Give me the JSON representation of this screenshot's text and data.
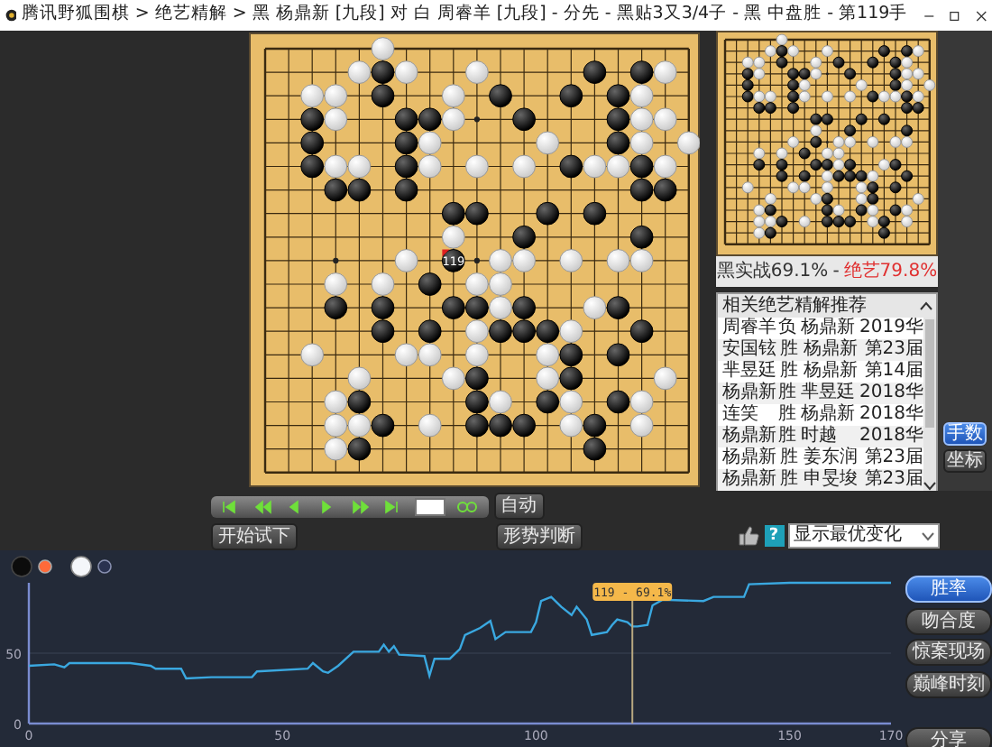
{
  "window": {
    "title": "腾讯野狐围棋 > 绝艺精解 > 黑 杨鼎新 [九段] 对 白 周睿羊 [九段] - 分先 - 黑贴3又3/4子 - 黑 中盘胜 - 第119手"
  },
  "board": {
    "rows": [
      {
        "points": [
          {
            "kind": "empty"
          },
          {
            "kind": "empty"
          },
          {
            "kind": "empty"
          },
          {
            "kind": "empty"
          },
          {
            "kind": "empty"
          },
          {
            "kind": "white"
          },
          {
            "kind": "empty"
          },
          {
            "kind": "empty"
          },
          {
            "kind": "empty"
          },
          {
            "kind": "empty"
          },
          {
            "kind": "empty"
          },
          {
            "kind": "empty"
          },
          {
            "kind": "empty"
          },
          {
            "kind": "empty"
          },
          {
            "kind": "empty"
          },
          {
            "kind": "empty"
          },
          {
            "kind": "empty"
          },
          {
            "kind": "empty"
          },
          {
            "kind": "empty"
          }
        ]
      },
      {
        "points": [
          {
            "kind": "empty"
          },
          {
            "kind": "empty"
          },
          {
            "kind": "empty"
          },
          {
            "kind": "empty"
          },
          {
            "kind": "white"
          },
          {
            "kind": "black"
          },
          {
            "kind": "white"
          },
          {
            "kind": "empty"
          },
          {
            "kind": "empty"
          },
          {
            "kind": "white"
          },
          {
            "kind": "empty"
          },
          {
            "kind": "empty"
          },
          {
            "kind": "empty"
          },
          {
            "kind": "empty"
          },
          {
            "kind": "black"
          },
          {
            "kind": "empty"
          },
          {
            "kind": "black"
          },
          {
            "kind": "white"
          },
          {
            "kind": "empty"
          }
        ]
      },
      {
        "points": [
          {
            "kind": "empty"
          },
          {
            "kind": "empty"
          },
          {
            "kind": "white"
          },
          {
            "kind": "white"
          },
          {
            "kind": "empty"
          },
          {
            "kind": "black"
          },
          {
            "kind": "empty"
          },
          {
            "kind": "empty"
          },
          {
            "kind": "white"
          },
          {
            "kind": "empty"
          },
          {
            "kind": "black"
          },
          {
            "kind": "empty"
          },
          {
            "kind": "empty"
          },
          {
            "kind": "black"
          },
          {
            "kind": "empty"
          },
          {
            "kind": "black"
          },
          {
            "kind": "white"
          },
          {
            "kind": "empty"
          },
          {
            "kind": "empty"
          }
        ]
      },
      {
        "points": [
          {
            "kind": "empty"
          },
          {
            "kind": "empty"
          },
          {
            "kind": "black"
          },
          {
            "kind": "white"
          },
          {
            "kind": "empty"
          },
          {
            "kind": "empty"
          },
          {
            "kind": "black"
          },
          {
            "kind": "black"
          },
          {
            "kind": "white"
          },
          {
            "kind": "empty"
          },
          {
            "kind": "empty"
          },
          {
            "kind": "black"
          },
          {
            "kind": "empty"
          },
          {
            "kind": "empty"
          },
          {
            "kind": "empty"
          },
          {
            "kind": "black"
          },
          {
            "kind": "white"
          },
          {
            "kind": "white"
          },
          {
            "kind": "empty"
          }
        ]
      },
      {
        "points": [
          {
            "kind": "empty"
          },
          {
            "kind": "empty"
          },
          {
            "kind": "black"
          },
          {
            "kind": "empty"
          },
          {
            "kind": "empty"
          },
          {
            "kind": "empty"
          },
          {
            "kind": "black"
          },
          {
            "kind": "white"
          },
          {
            "kind": "empty"
          },
          {
            "kind": "empty"
          },
          {
            "kind": "empty"
          },
          {
            "kind": "empty"
          },
          {
            "kind": "white"
          },
          {
            "kind": "empty"
          },
          {
            "kind": "empty"
          },
          {
            "kind": "black"
          },
          {
            "kind": "white"
          },
          {
            "kind": "empty"
          },
          {
            "kind": "white"
          }
        ]
      },
      {
        "points": [
          {
            "kind": "empty"
          },
          {
            "kind": "empty"
          },
          {
            "kind": "black"
          },
          {
            "kind": "white"
          },
          {
            "kind": "white"
          },
          {
            "kind": "empty"
          },
          {
            "kind": "black"
          },
          {
            "kind": "white"
          },
          {
            "kind": "empty"
          },
          {
            "kind": "white"
          },
          {
            "kind": "empty"
          },
          {
            "kind": "white"
          },
          {
            "kind": "empty"
          },
          {
            "kind": "black"
          },
          {
            "kind": "white"
          },
          {
            "kind": "white"
          },
          {
            "kind": "black"
          },
          {
            "kind": "white"
          },
          {
            "kind": "empty"
          }
        ]
      },
      {
        "points": [
          {
            "kind": "empty"
          },
          {
            "kind": "empty"
          },
          {
            "kind": "empty"
          },
          {
            "kind": "black"
          },
          {
            "kind": "black"
          },
          {
            "kind": "empty"
          },
          {
            "kind": "black"
          },
          {
            "kind": "empty"
          },
          {
            "kind": "empty"
          },
          {
            "kind": "empty"
          },
          {
            "kind": "empty"
          },
          {
            "kind": "empty"
          },
          {
            "kind": "empty"
          },
          {
            "kind": "empty"
          },
          {
            "kind": "empty"
          },
          {
            "kind": "empty"
          },
          {
            "kind": "black"
          },
          {
            "kind": "black"
          },
          {
            "kind": "empty"
          }
        ]
      },
      {
        "points": [
          {
            "kind": "empty"
          },
          {
            "kind": "empty"
          },
          {
            "kind": "empty"
          },
          {
            "kind": "empty"
          },
          {
            "kind": "empty"
          },
          {
            "kind": "empty"
          },
          {
            "kind": "empty"
          },
          {
            "kind": "empty"
          },
          {
            "kind": "black"
          },
          {
            "kind": "black"
          },
          {
            "kind": "empty"
          },
          {
            "kind": "empty"
          },
          {
            "kind": "black"
          },
          {
            "kind": "empty"
          },
          {
            "kind": "black"
          },
          {
            "kind": "empty"
          },
          {
            "kind": "empty"
          },
          {
            "kind": "empty"
          },
          {
            "kind": "empty"
          }
        ]
      },
      {
        "points": [
          {
            "kind": "empty"
          },
          {
            "kind": "empty"
          },
          {
            "kind": "empty"
          },
          {
            "kind": "empty"
          },
          {
            "kind": "empty"
          },
          {
            "kind": "empty"
          },
          {
            "kind": "empty"
          },
          {
            "kind": "empty"
          },
          {
            "kind": "white"
          },
          {
            "kind": "empty"
          },
          {
            "kind": "empty"
          },
          {
            "kind": "black"
          },
          {
            "kind": "empty"
          },
          {
            "kind": "empty"
          },
          {
            "kind": "empty"
          },
          {
            "kind": "empty"
          },
          {
            "kind": "black"
          },
          {
            "kind": "empty"
          },
          {
            "kind": "empty"
          }
        ]
      },
      {
        "points": [
          {
            "kind": "empty"
          },
          {
            "kind": "empty"
          },
          {
            "kind": "empty"
          },
          {
            "kind": "empty"
          },
          {
            "kind": "empty"
          },
          {
            "kind": "empty"
          },
          {
            "kind": "white"
          },
          {
            "kind": "empty"
          },
          {
            "kind": "black",
            "label": "119"
          },
          {
            "kind": "empty"
          },
          {
            "kind": "white"
          },
          {
            "kind": "white"
          },
          {
            "kind": "empty"
          },
          {
            "kind": "white"
          },
          {
            "kind": "empty"
          },
          {
            "kind": "white"
          },
          {
            "kind": "white"
          },
          {
            "kind": "empty"
          },
          {
            "kind": "empty"
          }
        ]
      },
      {
        "points": [
          {
            "kind": "empty"
          },
          {
            "kind": "empty"
          },
          {
            "kind": "empty"
          },
          {
            "kind": "white"
          },
          {
            "kind": "empty"
          },
          {
            "kind": "white"
          },
          {
            "kind": "empty"
          },
          {
            "kind": "black"
          },
          {
            "kind": "empty"
          },
          {
            "kind": "white"
          },
          {
            "kind": "white"
          },
          {
            "kind": "empty"
          },
          {
            "kind": "empty"
          },
          {
            "kind": "empty"
          },
          {
            "kind": "empty"
          },
          {
            "kind": "empty"
          },
          {
            "kind": "empty"
          },
          {
            "kind": "empty"
          },
          {
            "kind": "empty"
          }
        ]
      },
      {
        "points": [
          {
            "kind": "empty"
          },
          {
            "kind": "empty"
          },
          {
            "kind": "empty"
          },
          {
            "kind": "black"
          },
          {
            "kind": "empty"
          },
          {
            "kind": "black"
          },
          {
            "kind": "empty"
          },
          {
            "kind": "empty"
          },
          {
            "kind": "black"
          },
          {
            "kind": "black"
          },
          {
            "kind": "white"
          },
          {
            "kind": "black"
          },
          {
            "kind": "empty"
          },
          {
            "kind": "empty"
          },
          {
            "kind": "white"
          },
          {
            "kind": "black"
          },
          {
            "kind": "empty"
          },
          {
            "kind": "empty"
          },
          {
            "kind": "empty"
          }
        ]
      },
      {
        "points": [
          {
            "kind": "empty"
          },
          {
            "kind": "empty"
          },
          {
            "kind": "empty"
          },
          {
            "kind": "empty"
          },
          {
            "kind": "empty"
          },
          {
            "kind": "black"
          },
          {
            "kind": "empty"
          },
          {
            "kind": "black"
          },
          {
            "kind": "empty"
          },
          {
            "kind": "white"
          },
          {
            "kind": "black"
          },
          {
            "kind": "black"
          },
          {
            "kind": "black"
          },
          {
            "kind": "white"
          },
          {
            "kind": "empty"
          },
          {
            "kind": "empty"
          },
          {
            "kind": "black"
          },
          {
            "kind": "empty"
          },
          {
            "kind": "empty"
          }
        ]
      },
      {
        "points": [
          {
            "kind": "empty"
          },
          {
            "kind": "empty"
          },
          {
            "kind": "white"
          },
          {
            "kind": "empty"
          },
          {
            "kind": "empty"
          },
          {
            "kind": "empty"
          },
          {
            "kind": "white"
          },
          {
            "kind": "white"
          },
          {
            "kind": "empty"
          },
          {
            "kind": "white"
          },
          {
            "kind": "empty"
          },
          {
            "kind": "empty"
          },
          {
            "kind": "white"
          },
          {
            "kind": "black"
          },
          {
            "kind": "empty"
          },
          {
            "kind": "black"
          },
          {
            "kind": "empty"
          },
          {
            "kind": "empty"
          },
          {
            "kind": "empty"
          }
        ]
      },
      {
        "points": [
          {
            "kind": "empty"
          },
          {
            "kind": "empty"
          },
          {
            "kind": "empty"
          },
          {
            "kind": "empty"
          },
          {
            "kind": "white"
          },
          {
            "kind": "empty"
          },
          {
            "kind": "empty"
          },
          {
            "kind": "empty"
          },
          {
            "kind": "white"
          },
          {
            "kind": "black"
          },
          {
            "kind": "empty"
          },
          {
            "kind": "empty"
          },
          {
            "kind": "white"
          },
          {
            "kind": "black"
          },
          {
            "kind": "empty"
          },
          {
            "kind": "empty"
          },
          {
            "kind": "empty"
          },
          {
            "kind": "white"
          },
          {
            "kind": "empty"
          }
        ]
      },
      {
        "points": [
          {
            "kind": "empty"
          },
          {
            "kind": "empty"
          },
          {
            "kind": "empty"
          },
          {
            "kind": "white"
          },
          {
            "kind": "black"
          },
          {
            "kind": "empty"
          },
          {
            "kind": "empty"
          },
          {
            "kind": "empty"
          },
          {
            "kind": "empty"
          },
          {
            "kind": "black"
          },
          {
            "kind": "white"
          },
          {
            "kind": "empty"
          },
          {
            "kind": "black"
          },
          {
            "kind": "white"
          },
          {
            "kind": "empty"
          },
          {
            "kind": "black"
          },
          {
            "kind": "white"
          },
          {
            "kind": "empty"
          },
          {
            "kind": "empty"
          }
        ]
      },
      {
        "points": [
          {
            "kind": "empty"
          },
          {
            "kind": "empty"
          },
          {
            "kind": "empty"
          },
          {
            "kind": "white"
          },
          {
            "kind": "white"
          },
          {
            "kind": "black"
          },
          {
            "kind": "empty"
          },
          {
            "kind": "white"
          },
          {
            "kind": "empty"
          },
          {
            "kind": "black"
          },
          {
            "kind": "black"
          },
          {
            "kind": "black"
          },
          {
            "kind": "empty"
          },
          {
            "kind": "white"
          },
          {
            "kind": "black"
          },
          {
            "kind": "empty"
          },
          {
            "kind": "white"
          },
          {
            "kind": "empty"
          },
          {
            "kind": "empty"
          }
        ]
      },
      {
        "points": [
          {
            "kind": "empty"
          },
          {
            "kind": "empty"
          },
          {
            "kind": "empty"
          },
          {
            "kind": "white"
          },
          {
            "kind": "black"
          },
          {
            "kind": "empty"
          },
          {
            "kind": "empty"
          },
          {
            "kind": "empty"
          },
          {
            "kind": "empty"
          },
          {
            "kind": "empty"
          },
          {
            "kind": "empty"
          },
          {
            "kind": "empty"
          },
          {
            "kind": "empty"
          },
          {
            "kind": "empty"
          },
          {
            "kind": "black"
          },
          {
            "kind": "empty"
          },
          {
            "kind": "empty"
          },
          {
            "kind": "empty"
          },
          {
            "kind": "empty"
          }
        ]
      },
      {
        "points": [
          {
            "kind": "empty"
          },
          {
            "kind": "empty"
          },
          {
            "kind": "empty"
          },
          {
            "kind": "empty"
          },
          {
            "kind": "empty"
          },
          {
            "kind": "empty"
          },
          {
            "kind": "empty"
          },
          {
            "kind": "empty"
          },
          {
            "kind": "empty"
          },
          {
            "kind": "empty"
          },
          {
            "kind": "empty"
          },
          {
            "kind": "empty"
          },
          {
            "kind": "empty"
          },
          {
            "kind": "empty"
          },
          {
            "kind": "empty"
          },
          {
            "kind": "empty"
          },
          {
            "kind": "empty"
          },
          {
            "kind": "empty"
          },
          {
            "kind": "empty"
          }
        ]
      }
    ]
  },
  "win_rate": {
    "actual": "黑实战69.1%",
    "separator": "-",
    "ai": "绝艺79.8%"
  },
  "recommendations": {
    "title": "相关绝艺精解推荐",
    "rows": [
      {
        "player_1": "周睿羊",
        "result": "负",
        "player_2": "杨鼎新",
        "event": "2019华"
      },
      {
        "player_1": "安国铉",
        "result": "胜",
        "player_2": "杨鼎新",
        "event": "第23届"
      },
      {
        "player_1": "芈昱廷",
        "result": "胜",
        "player_2": "杨鼎新",
        "event": "第14届"
      },
      {
        "player_1": "杨鼎新",
        "result": "胜",
        "player_2": "芈昱廷",
        "event": "2018华"
      },
      {
        "player_1": "连笑",
        "result": "胜",
        "player_2": "杨鼎新",
        "event": "2018华"
      },
      {
        "player_1": "杨鼎新",
        "result": "胜",
        "player_2": "时越",
        "event": "2018华"
      },
      {
        "player_1": "杨鼎新",
        "result": "胜",
        "player_2": "姜东润",
        "event": "第23届"
      },
      {
        "player_1": "杨鼎新",
        "result": "胜",
        "player_2": "申旻埈",
        "event": "第23届"
      }
    ]
  },
  "side_buttons": [
    {
      "label": "手数",
      "selected": true
    },
    {
      "label": "坐标",
      "selected": false
    }
  ],
  "playback": {
    "auto": "自动"
  },
  "buttons": [
    "开始试下",
    "形势判断"
  ],
  "help_label": "?",
  "variation_select": {
    "value": "显示最优变化"
  },
  "chart_panel": {
    "chart_data": {
      "type": "line",
      "x": [
        0,
        5,
        7,
        8,
        20,
        24,
        25,
        30,
        31,
        36,
        44,
        45,
        55,
        56,
        58,
        59,
        61,
        64,
        69,
        70,
        71,
        72,
        73,
        78,
        79,
        80,
        83,
        85,
        86,
        89,
        91,
        92,
        94,
        99,
        100,
        101,
        103,
        105,
        107,
        108,
        110,
        111,
        114,
        115,
        116,
        118,
        119,
        120,
        122,
        123,
        125,
        133,
        135,
        141,
        142,
        150,
        170
      ],
      "series": [
        {
          "color": "#3aa8e0",
          "values": [
            41,
            42,
            40,
            43,
            43,
            41,
            39,
            39,
            32,
            33,
            33,
            37,
            39,
            43,
            37,
            36,
            41,
            51,
            51,
            56,
            51,
            55,
            49,
            48,
            34,
            46,
            46,
            53,
            63,
            68,
            73,
            60,
            65,
            65,
            72,
            87,
            90,
            83,
            77,
            83,
            74,
            63,
            65,
            70,
            74,
            72,
            69,
            69,
            70,
            84,
            88,
            87,
            90,
            90,
            99,
            100,
            100
          ]
        }
      ],
      "xlim": [
        0,
        170
      ],
      "ylim": [
        0,
        100
      ],
      "xticks": [
        0,
        50,
        100,
        150,
        170
      ],
      "yticks": [
        0,
        50
      ],
      "ref_lines": [
        {
          "axis": "x",
          "value": 119
        }
      ],
      "annotations": [
        {
          "x": 119,
          "text": "119 - 69.1%"
        }
      ]
    },
    "modes": [
      {
        "label": "胜率",
        "selected": true
      },
      {
        "label": "吻合度",
        "selected": false
      },
      {
        "label": "惊案现场",
        "selected": false
      },
      {
        "label": "巅峰时刻",
        "selected": false
      }
    ],
    "share": "分享"
  }
}
